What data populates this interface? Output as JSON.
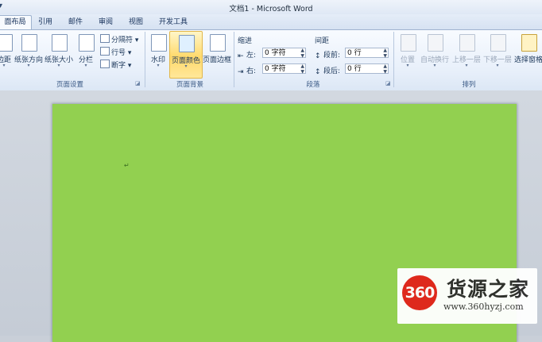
{
  "window": {
    "title": "文档1 - Microsoft Word"
  },
  "tabs": [
    {
      "label": "面布局",
      "active": true
    },
    {
      "label": "引用",
      "active": false
    },
    {
      "label": "邮件",
      "active": false
    },
    {
      "label": "审阅",
      "active": false
    },
    {
      "label": "视图",
      "active": false
    },
    {
      "label": "开发工具",
      "active": false
    }
  ],
  "ribbon": {
    "page_setup": {
      "label": "页面设置",
      "margins": "边距",
      "orientation": "纸张方向",
      "size": "纸张大小",
      "columns": "分栏",
      "breaks": "分隔符",
      "line_numbers": "行号",
      "hyphenation": "断字"
    },
    "page_background": {
      "label": "页面背景",
      "watermark": "水印",
      "page_color": "页面颜色",
      "page_borders": "页面边框"
    },
    "paragraph": {
      "label": "段落",
      "indent_title": "缩进",
      "indent_left_label": "左:",
      "indent_left_value": "0 字符",
      "indent_right_label": "右:",
      "indent_right_value": "0 字符",
      "spacing_title": "间距",
      "spacing_before_label": "段前:",
      "spacing_before_value": "0 行",
      "spacing_after_label": "段后:",
      "spacing_after_value": "0 行"
    },
    "arrange": {
      "label": "排列",
      "position": "位置",
      "wrap_text": "自动换行",
      "bring_forward": "上移一层",
      "send_backward": "下移一层",
      "selection_pane": "选择窗格"
    }
  },
  "document": {
    "page_color": "#92d050",
    "paragraph_mark": "↵"
  },
  "watermark": {
    "badge": "360",
    "name": "货源之家",
    "url": "www.360hyzj.com"
  }
}
